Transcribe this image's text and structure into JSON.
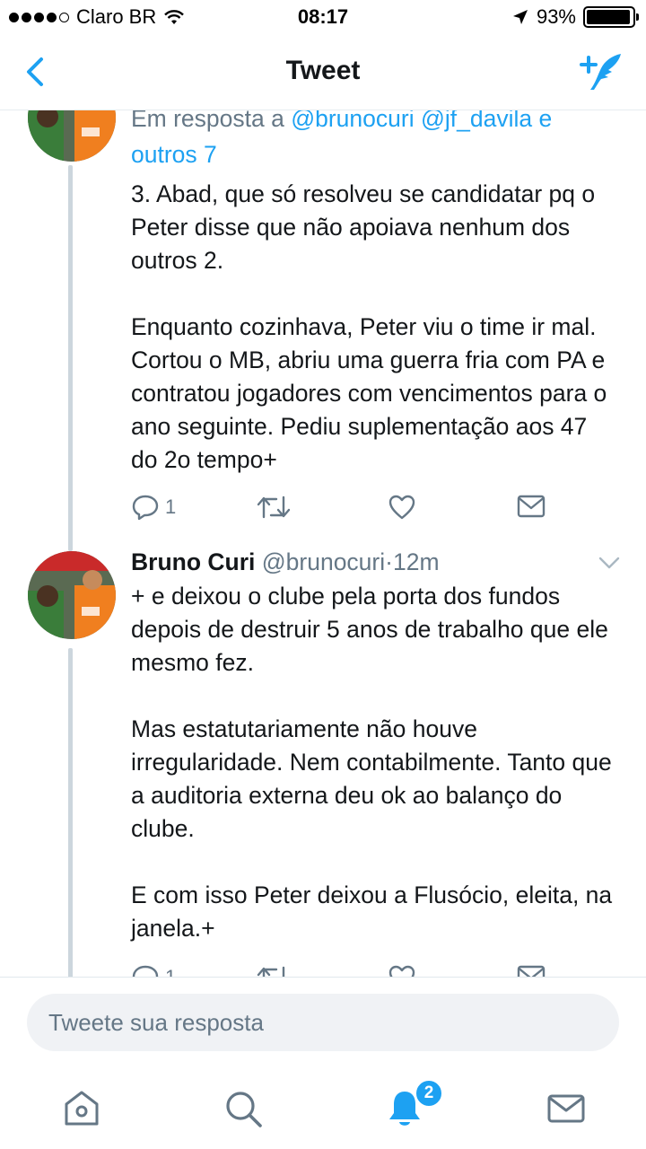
{
  "status_bar": {
    "carrier": "Claro BR",
    "time": "08:17",
    "battery_percent": "93%",
    "battery_level": 0.93,
    "signal_bars_filled": 4
  },
  "nav": {
    "title": "Tweet",
    "back_icon": "chevron-left-icon",
    "compose_icon": "compose-tweet-icon",
    "accent_color": "#1da1f2"
  },
  "tweets": [
    {
      "reply_prefix": "Em resposta a ",
      "reply_mentions": "@brunocuri @jf_davila e outros 7",
      "text": "3. Abad, que só resolveu se candidatar pq o Peter disse que não apoiava nenhum dos outros 2.\n\nEnquanto cozinhava, Peter viu o time ir mal. Cortou o MB, abriu uma guerra fria com PA e contratou jogadores com vencimentos para o ano seguinte. Pediu suplementação aos 47 do 2o tempo+",
      "reply_count": "1"
    },
    {
      "name": "Bruno Curi",
      "handle": "@brunocuri",
      "separator": "·",
      "time": "12m",
      "text": "+ e deixou o clube pela porta dos fundos depois de destruir 5 anos de trabalho que ele mesmo fez.\n\nMas estatutariamente não houve irregularidade. Nem contabilmente. Tanto que a auditoria externa deu ok ao balanço do clube.\n\nE com isso Peter deixou a Flusócio, eleita, na janela.+",
      "reply_count": "1"
    }
  ],
  "reply": {
    "placeholder": "Tweete sua resposta"
  },
  "tabbar": {
    "items": [
      "home-icon",
      "search-icon",
      "notifications-icon",
      "messages-icon"
    ],
    "notification_badge": "2"
  }
}
